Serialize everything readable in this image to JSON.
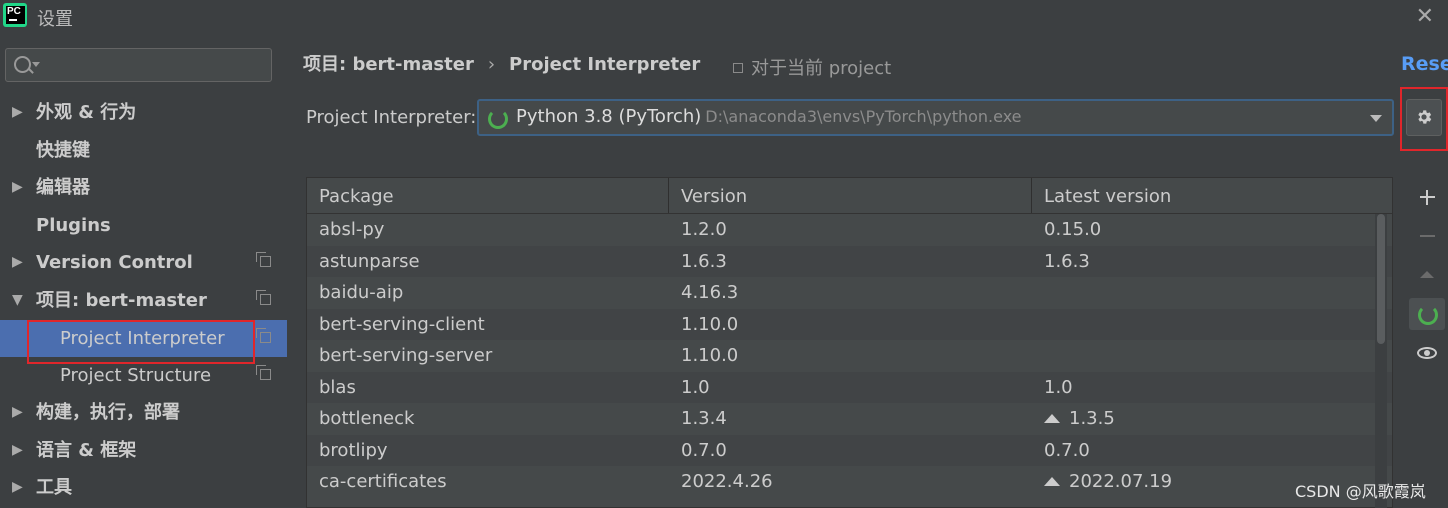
{
  "window": {
    "title": "设置",
    "logo_text": "PC"
  },
  "search": {
    "value": "",
    "placeholder": ""
  },
  "sidebar": {
    "items": [
      {
        "label": "外观 & 行为",
        "arrow": "▶"
      },
      {
        "label": "快捷键",
        "arrow": ""
      },
      {
        "label": "编辑器",
        "arrow": "▶"
      },
      {
        "label": "Plugins",
        "arrow": ""
      },
      {
        "label": "Version Control",
        "arrow": "▶"
      },
      {
        "label": "项目: bert-master",
        "arrow": "▼"
      },
      {
        "label": "Project Interpreter",
        "arrow": ""
      },
      {
        "label": "Project Structure",
        "arrow": ""
      },
      {
        "label": "构建，执行，部署",
        "arrow": "▶"
      },
      {
        "label": "语言 & 框架",
        "arrow": "▶"
      },
      {
        "label": "工具",
        "arrow": "▶"
      }
    ]
  },
  "main": {
    "breadcrumb": {
      "parent": "项目: bert-master",
      "separator": "›",
      "current": "Project Interpreter"
    },
    "scope_note": "对于当前 project",
    "reset_label": "Reset",
    "interpreter_label": "Project Interpreter:",
    "interpreter": {
      "name": "Python 3.8 (PyTorch)",
      "path": "D:\\anaconda3\\envs\\PyTorch\\python.exe"
    }
  },
  "table": {
    "headers": [
      "Package",
      "Version",
      "Latest version"
    ],
    "rows": [
      {
        "package": "absl-py",
        "version": "1.2.0",
        "latest": "0.15.0",
        "upgrade": false
      },
      {
        "package": "astunparse",
        "version": "1.6.3",
        "latest": "1.6.3",
        "upgrade": false
      },
      {
        "package": "baidu-aip",
        "version": "4.16.3",
        "latest": "",
        "upgrade": false
      },
      {
        "package": "bert-serving-client",
        "version": "1.10.0",
        "latest": "",
        "upgrade": false
      },
      {
        "package": "bert-serving-server",
        "version": "1.10.0",
        "latest": "",
        "upgrade": false
      },
      {
        "package": "blas",
        "version": "1.0",
        "latest": "1.0",
        "upgrade": false
      },
      {
        "package": "bottleneck",
        "version": "1.3.4",
        "latest": "1.3.5",
        "upgrade": true
      },
      {
        "package": "brotlipy",
        "version": "0.7.0",
        "latest": "0.7.0",
        "upgrade": false
      },
      {
        "package": "ca-certificates",
        "version": "2022.4.26",
        "latest": "2022.07.19",
        "upgrade": true
      }
    ]
  },
  "watermark": "CSDN @风歌霞岚"
}
